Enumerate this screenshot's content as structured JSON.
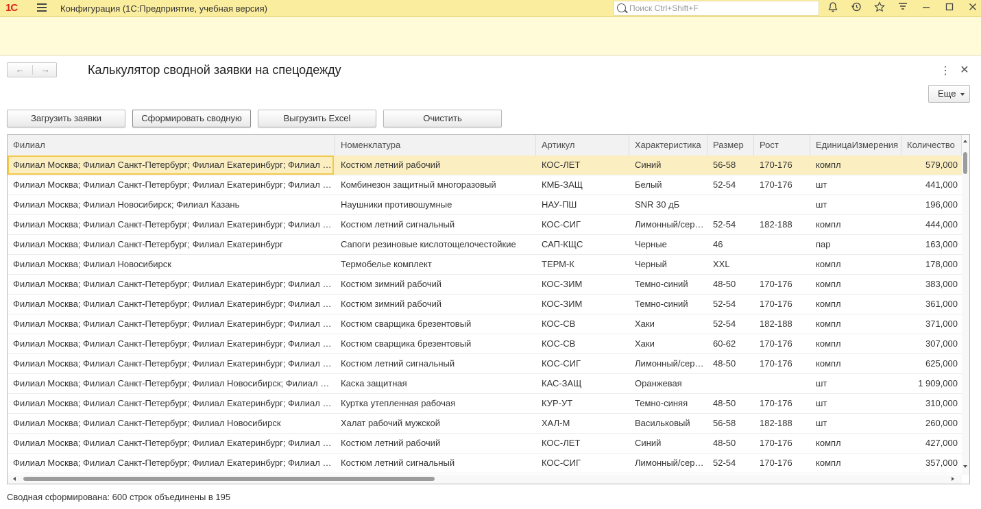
{
  "app": {
    "logo": "1С",
    "title": "Конфигурация  (1С:Предприятие, учебная версия)",
    "search_placeholder": "Поиск Ctrl+Shift+F"
  },
  "form": {
    "title": "Калькулятор сводной заявки на спецодежду",
    "more_label": "Еще",
    "buttons": {
      "load": "Загрузить заявки",
      "build": "Сформировать сводную",
      "export": "Выгрузить Excel",
      "clear": "Очистить"
    },
    "status": "Сводная сформирована: 600 строк объединены в 195"
  },
  "table": {
    "columns": [
      "Филиал",
      "Номенклатура",
      "Артикул",
      "Характеристика",
      "Размер",
      "Рост",
      "ЕдиницаИзмерения",
      "Количество"
    ],
    "rows": [
      [
        "Филиал Москва; Филиал Санкт-Петербург; Филиал Екатеринбург; Филиал Новосибирск",
        "Костюм летний рабочий",
        "КОС-ЛЕТ",
        "Синий",
        "56-58",
        "170-176",
        "компл",
        "579,000"
      ],
      [
        "Филиал Москва; Филиал Санкт-Петербург; Филиал Екатеринбург; Филиал Новосибирск",
        "Комбинезон защитный многоразовый",
        "КМБ-ЗАЩ",
        "Белый",
        "52-54",
        "170-176",
        "шт",
        "441,000"
      ],
      [
        "Филиал Москва; Филиал Новосибирск; Филиал Казань",
        "Наушники противошумные",
        "НАУ-ПШ",
        "SNR 30 дБ",
        "",
        "",
        "шт",
        "196,000"
      ],
      [
        "Филиал Москва; Филиал Санкт-Петербург; Филиал Екатеринбург; Филиал Новосибирск",
        "Костюм летний сигнальный",
        "КОС-СИГ",
        "Лимонный/серый",
        "52-54",
        "182-188",
        "компл",
        "444,000"
      ],
      [
        "Филиал Москва; Филиал Санкт-Петербург; Филиал Екатеринбург",
        "Сапоги резиновые кислотощелочестойкие",
        "САП-КЩС",
        "Черные",
        "46",
        "",
        "пар",
        "163,000"
      ],
      [
        "Филиал Москва; Филиал Новосибирск",
        "Термобелье комплект",
        "ТЕРМ-К",
        "Черный",
        "XXL",
        "",
        "компл",
        "178,000"
      ],
      [
        "Филиал Москва; Филиал Санкт-Петербург; Филиал Екатеринбург; Филиал Новосибирск",
        "Костюм зимний рабочий",
        "КОС-ЗИМ",
        "Темно-синий",
        "48-50",
        "170-176",
        "компл",
        "383,000"
      ],
      [
        "Филиал Москва; Филиал Санкт-Петербург; Филиал Екатеринбург; Филиал Новосибирск",
        "Костюм зимний рабочий",
        "КОС-ЗИМ",
        "Темно-синий",
        "52-54",
        "170-176",
        "компл",
        "361,000"
      ],
      [
        "Филиал Москва; Филиал Санкт-Петербург; Филиал Екатеринбург; Филиал Новосибирск",
        "Костюм сварщика брезентовый",
        "КОС-СВ",
        "Хаки",
        "52-54",
        "182-188",
        "компл",
        "371,000"
      ],
      [
        "Филиал Москва; Филиал Санкт-Петербург; Филиал Екатеринбург; Филиал Новосибирск",
        "Костюм сварщика брезентовый",
        "КОС-СВ",
        "Хаки",
        "60-62",
        "170-176",
        "компл",
        "307,000"
      ],
      [
        "Филиал Москва; Филиал Санкт-Петербург; Филиал Екатеринбург; Филиал Новосибирск",
        "Костюм летний сигнальный",
        "КОС-СИГ",
        "Лимонный/серый",
        "48-50",
        "170-176",
        "компл",
        "625,000"
      ],
      [
        "Филиал Москва; Филиал Санкт-Петербург; Филиал Новосибирск; Филиал Казань",
        "Каска защитная",
        "КАС-ЗАЩ",
        "Оранжевая",
        "",
        "",
        "шт",
        "1 909,000"
      ],
      [
        "Филиал Москва; Филиал Санкт-Петербург; Филиал Екатеринбург; Филиал Новосибирск",
        "Куртка утепленная рабочая",
        "КУР-УТ",
        "Темно-синяя",
        "48-50",
        "170-176",
        "шт",
        "310,000"
      ],
      [
        "Филиал Москва; Филиал Санкт-Петербург; Филиал Новосибирск",
        "Халат рабочий мужской",
        "ХАЛ-М",
        "Васильковый",
        "56-58",
        "182-188",
        "шт",
        "260,000"
      ],
      [
        "Филиал Москва; Филиал Санкт-Петербург; Филиал Екатеринбург; Филиал Новосибирск",
        "Костюм летний рабочий",
        "КОС-ЛЕТ",
        "Синий",
        "48-50",
        "170-176",
        "компл",
        "427,000"
      ],
      [
        "Филиал Москва; Филиал Санкт-Петербург; Филиал Екатеринбург; Филиал Новосибирск",
        "Костюм летний сигнальный",
        "КОС-СИГ",
        "Лимонный/серый",
        "52-54",
        "170-176",
        "компл",
        "357,000"
      ]
    ]
  }
}
